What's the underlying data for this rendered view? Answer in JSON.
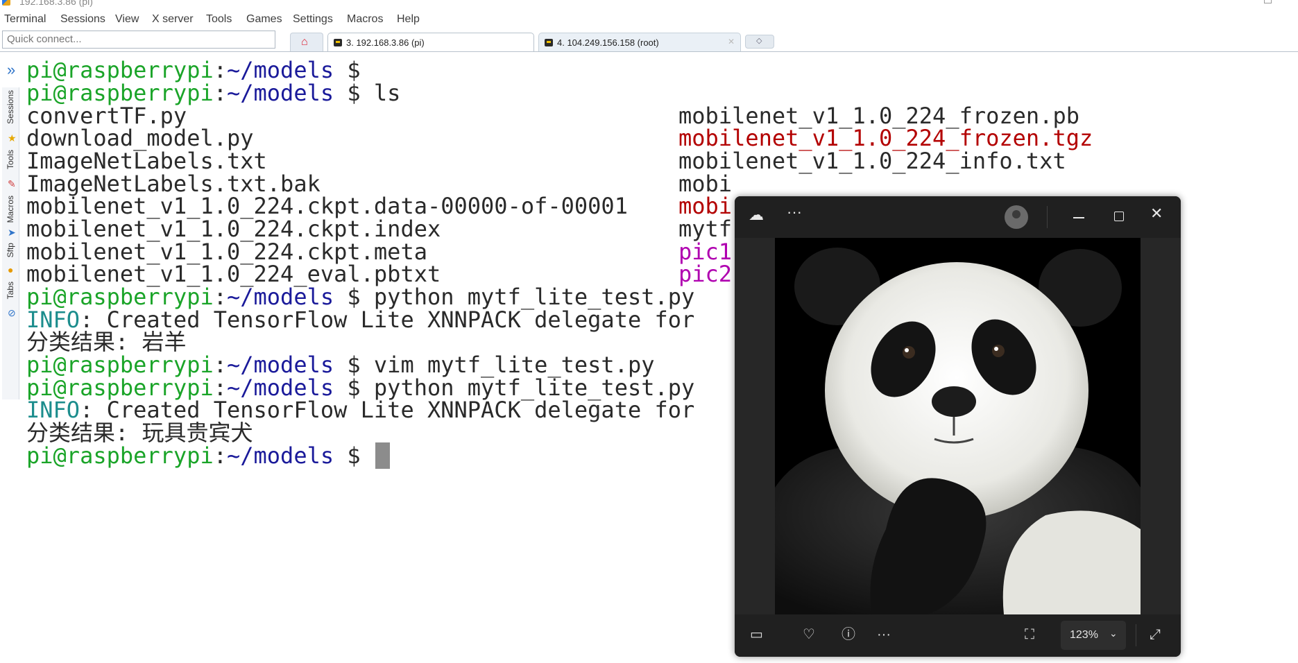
{
  "window": {
    "title": "192.168.3.86 (pi)"
  },
  "menu": [
    "Terminal",
    "Sessions",
    "View",
    "X server",
    "Tools",
    "Games",
    "Settings",
    "Macros",
    "Help"
  ],
  "quick_connect": {
    "placeholder": "Quick connect..."
  },
  "tabs": [
    {
      "label": "3. 192.168.3.86 (pi)",
      "active": true
    },
    {
      "label": "4. 104.249.156.158 (root)",
      "active": false
    }
  ],
  "sidebar": {
    "labels": [
      "Sessions",
      "Tools",
      "Macros",
      "Sftp",
      "Tabs"
    ]
  },
  "terminal": {
    "prompt_user": "pi@raspberrypi",
    "prompt_path": "~/models",
    "prompt_symbol": "$",
    "commands": {
      "ls": "ls",
      "run1": "python mytf_lite_test.py",
      "vim": "vim mytf_lite_test.py",
      "run2": "python mytf_lite_test.py"
    },
    "ls_col1": [
      "convertTF.py",
      "download_model.py",
      "ImageNetLabels.txt",
      "ImageNetLabels.txt.bak",
      "mobilenet_v1_1.0_224.ckpt.data-00000-of-00001",
      "mobilenet_v1_1.0_224.ckpt.index",
      "mobilenet_v1_1.0_224.ckpt.meta",
      "mobilenet_v1_1.0_224_eval.pbtxt"
    ],
    "ls_col2": [
      "mobilenet_v1_1.0_224_frozen.pb",
      "mobilenet_v1_1.0_224_frozen.tgz",
      "mobilenet_v1_1.0_224_info.txt",
      "mobi",
      "mobi",
      "mytf",
      "pic1",
      "pic2"
    ],
    "info_tag": "INFO",
    "info_text": ": Created TensorFlow Lite XNNPACK delegate for",
    "result_label": "分类结果: ",
    "result1": "岩羊",
    "result2": "玩具贵宾犬"
  },
  "photo_viewer": {
    "image_subject": "giant panda",
    "zoom": "123%"
  },
  "colors": {
    "prompt_user": "#1aa428",
    "prompt_path": "#1a1a9a",
    "info": "#1c8d8d",
    "archive_file": "#b30000",
    "image_file": "#b000b0",
    "viewer_bg": "#202020"
  }
}
